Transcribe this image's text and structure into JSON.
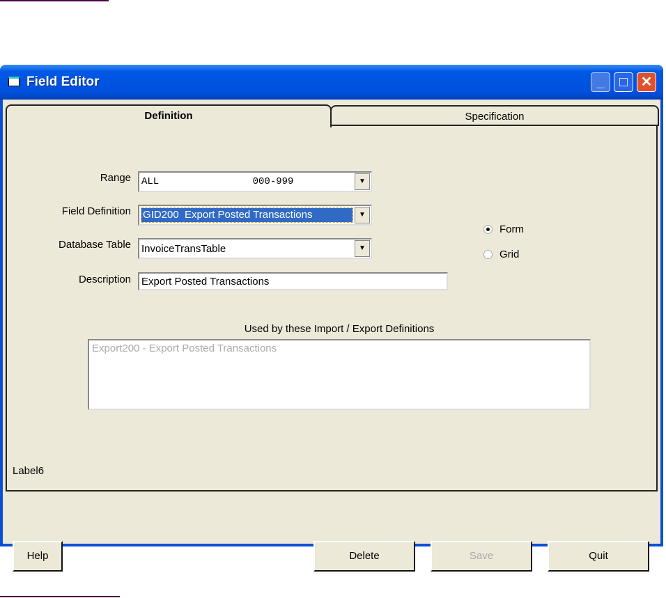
{
  "window": {
    "title": "Field Editor",
    "icon": "app-window-icon",
    "controls": [
      "minimize-icon",
      "maximize-icon",
      "close-icon"
    ]
  },
  "tabs": [
    {
      "label": "Definition",
      "selected": true
    },
    {
      "label": "Specification",
      "selected": false
    }
  ],
  "form": {
    "range": {
      "label": "Range",
      "value": "ALL                000-999"
    },
    "field_definition": {
      "label": "Field Definition",
      "value": "GID200  Export Posted Transactions"
    },
    "database_table": {
      "label": "Database Table",
      "value": "InvoiceTransTable"
    },
    "description": {
      "label": "Description",
      "value": "Export Posted Transactions"
    }
  },
  "view_mode": {
    "options": [
      {
        "label": "Form",
        "checked": true
      },
      {
        "label": "Grid",
        "checked": false
      }
    ]
  },
  "used_by": {
    "label": "Used by these Import / Export Definitions",
    "items": [
      "Export200 - Export Posted Transactions"
    ]
  },
  "status_label": "Label6",
  "buttons": {
    "help": "Help",
    "delete": "Delete",
    "save": "Save",
    "quit": "Quit"
  },
  "colors": {
    "titlebar": "#0058e6",
    "selection": "#316ac5",
    "face": "#ece9d8",
    "close": "#e0502a"
  }
}
